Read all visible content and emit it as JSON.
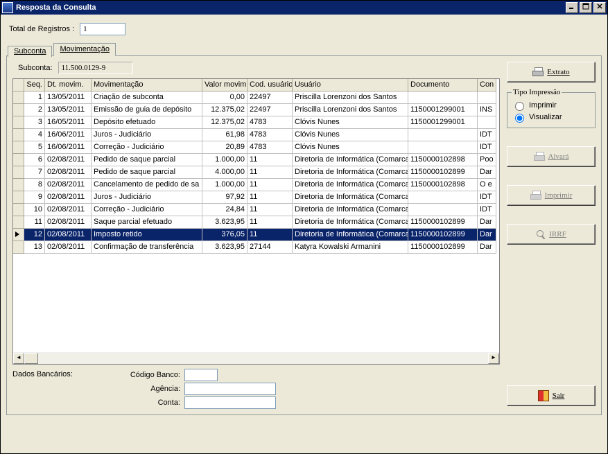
{
  "window": {
    "title": "Resposta da Consulta",
    "min_tip": "Minimize",
    "max_tip": "Maximize",
    "close_tip": "Close"
  },
  "top": {
    "total_label": "Total de Registros :",
    "total_value": "1"
  },
  "tabs": {
    "subconta": "Subconta",
    "movimentacao": "Movimentação"
  },
  "subconta_line": {
    "label": "Subconta:",
    "value": "11.500.0129-9"
  },
  "grid": {
    "headers": {
      "seq": "Seq.",
      "dt": "Dt. movim.",
      "mov": "Movimentação",
      "val": "Valor movim.",
      "cod": "Cod. usuário",
      "usr": "Usuário",
      "doc": "Documento",
      "con": "Con"
    },
    "rows": [
      {
        "seq": "1",
        "dt": "13/05/2011",
        "mov": "Criação de subconta",
        "val": "0,00",
        "cod": "22497",
        "usr": "Priscilla Lorenzoni dos Santos",
        "doc": "",
        "con": ""
      },
      {
        "seq": "2",
        "dt": "13/05/2011",
        "mov": "Emissão de guia de depósito",
        "val": "12.375,02",
        "cod": "22497",
        "usr": "Priscilla Lorenzoni dos Santos",
        "doc": "1150001299001",
        "con": "INS"
      },
      {
        "seq": "3",
        "dt": "16/05/2011",
        "mov": "Depósito efetuado",
        "val": "12.375,02",
        "cod": "4783",
        "usr": "Clóvis Nunes",
        "doc": "1150001299001",
        "con": ""
      },
      {
        "seq": "4",
        "dt": "16/06/2011",
        "mov": "Juros - Judiciário",
        "val": "61,98",
        "cod": "4783",
        "usr": "Clóvis Nunes",
        "doc": "",
        "con": "IDT"
      },
      {
        "seq": "5",
        "dt": "16/06/2011",
        "mov": "Correção - Judiciário",
        "val": "20,89",
        "cod": "4783",
        "usr": "Clóvis Nunes",
        "doc": "",
        "con": "IDT"
      },
      {
        "seq": "6",
        "dt": "02/08/2011",
        "mov": "Pedido de saque parcial",
        "val": "1.000,00",
        "cod": "11",
        "usr": "Diretoria de Informática (Comarca)",
        "doc": "1150000102898",
        "con": "Poo"
      },
      {
        "seq": "7",
        "dt": "02/08/2011",
        "mov": "Pedido de saque parcial",
        "val": "4.000,00",
        "cod": "11",
        "usr": "Diretoria de Informática (Comarca)",
        "doc": "1150000102899",
        "con": "Dar"
      },
      {
        "seq": "8",
        "dt": "02/08/2011",
        "mov": "Cancelamento de pedido de sa",
        "val": "1.000,00",
        "cod": "11",
        "usr": "Diretoria de Informática (Comarca)",
        "doc": "1150000102898",
        "con": "O e"
      },
      {
        "seq": "9",
        "dt": "02/08/2011",
        "mov": "Juros - Judiciário",
        "val": "97,92",
        "cod": "11",
        "usr": "Diretoria de Informática (Comarca)",
        "doc": "",
        "con": "IDT"
      },
      {
        "seq": "10",
        "dt": "02/08/2011",
        "mov": "Correção - Judiciário",
        "val": "24,84",
        "cod": "11",
        "usr": "Diretoria de Informática (Comarca)",
        "doc": "",
        "con": "IDT"
      },
      {
        "seq": "11",
        "dt": "02/08/2011",
        "mov": "Saque parcial efetuado",
        "val": "3.623,95",
        "cod": "11",
        "usr": "Diretoria de Informática (Comarca)",
        "doc": "1150000102899",
        "con": "Dar"
      },
      {
        "seq": "12",
        "dt": "02/08/2011",
        "mov": "Imposto retido",
        "val": "376,05",
        "cod": "11",
        "usr": "Diretoria de Informática (Comarca)",
        "doc": "1150000102899",
        "con": "Dar",
        "selected": true
      },
      {
        "seq": "13",
        "dt": "02/08/2011",
        "mov": "Confirmação de transferência",
        "val": "3.623,95",
        "cod": "27144",
        "usr": "Katyra Kowalski Armanini",
        "doc": "1150000102899",
        "con": "Dar"
      }
    ]
  },
  "dados": {
    "title": "Dados Bancários:",
    "codigo_banco_label": "Código Banco:",
    "codigo_banco_value": "",
    "agencia_label": "Agência:",
    "agencia_value": "",
    "conta_label": "Conta:",
    "conta_value": ""
  },
  "buttons": {
    "extrato": "Extrato",
    "tipo_legend": "Tipo Impressão",
    "imprimir_radio": "Imprimir",
    "visualizar_radio": "Visualizar",
    "alvara": "Alvará",
    "imprimir_btn": "Imprimir",
    "irrf": "IRRF",
    "sair": "Sair"
  }
}
